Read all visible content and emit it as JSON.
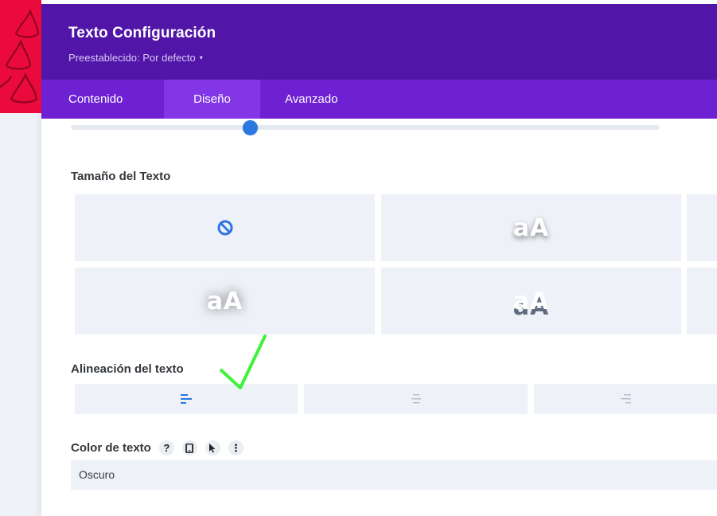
{
  "modal": {
    "title": "Texto Configuración",
    "preset_label": "Preestablecido: Por defecto",
    "caret": "▾"
  },
  "tabs": [
    {
      "label": "Contenido",
      "active": false
    },
    {
      "label": "Diseño",
      "active": true
    },
    {
      "label": "Avanzado",
      "active": false
    }
  ],
  "slider": {
    "value_fraction": 0.31
  },
  "text_size": {
    "label": "Tamaño del Texto",
    "options": [
      {
        "icon": "no-shadow-icon",
        "preview": ""
      },
      {
        "icon": "",
        "preview": "aA"
      },
      {
        "icon": "",
        "preview": ""
      },
      {
        "icon": "",
        "preview": "aA"
      },
      {
        "icon": "",
        "preview": "aA"
      },
      {
        "icon": "",
        "preview": ""
      }
    ]
  },
  "alignment": {
    "label": "Alineación del texto",
    "options": [
      {
        "icon": "align-left-icon",
        "active": true
      },
      {
        "icon": "align-center-icon",
        "active": false
      },
      {
        "icon": "align-right-icon",
        "active": false
      }
    ]
  },
  "text_color": {
    "label": "Color de texto",
    "help": "?",
    "more": "⋮",
    "selected": "Oscuro"
  },
  "colors": {
    "header_bg": "#5116a8",
    "tabs_bg": "#6e21d2",
    "tab_active_bg": "#8336e6",
    "accent_blue": "#2c77e0",
    "check_green": "#3ff23a",
    "sidebar_red": "#ea0a3b"
  }
}
